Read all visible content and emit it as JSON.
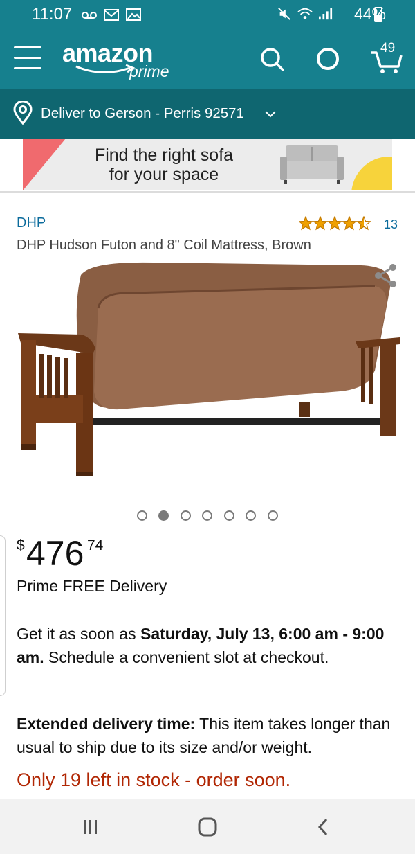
{
  "status_bar": {
    "time": "11:07",
    "battery": "44%"
  },
  "header": {
    "logo_word": "amazon",
    "logo_sub": "prime",
    "cart_count": "49",
    "icons": [
      "menu-icon",
      "search-icon",
      "alexa-icon",
      "cart-icon"
    ]
  },
  "deliver": {
    "text": "Deliver to Gerson - Perris 92571"
  },
  "banner": {
    "line1": "Find the right sofa",
    "line2": "for your space"
  },
  "product": {
    "brand": "DHP",
    "rating": 4.5,
    "review_count": "13",
    "title": "DHP Hudson Futon and 8\" Coil Mattress, Brown",
    "image_count": 7,
    "active_image": 2
  },
  "price": {
    "currency": "$",
    "whole": "476",
    "fraction": "74"
  },
  "delivery": {
    "prime_free": "Prime FREE Delivery",
    "get_it_prefix": "Get it as soon as ",
    "get_it_bold": "Saturday, July 13, 6:00 am - 9:00 am.",
    "get_it_suffix": " Schedule a convenient slot at checkout.",
    "extended_bold": "Extended delivery time:",
    "extended_text": " This item takes longer than usual to ship due to its size and/or weight."
  },
  "stock": {
    "text": "Only 19 left in stock - order soon."
  },
  "colors": {
    "header": "#16808e",
    "deliver_bar": "#0f6670",
    "link": "#0b6b9c",
    "stock": "#b12704",
    "star": "#f0a100"
  }
}
